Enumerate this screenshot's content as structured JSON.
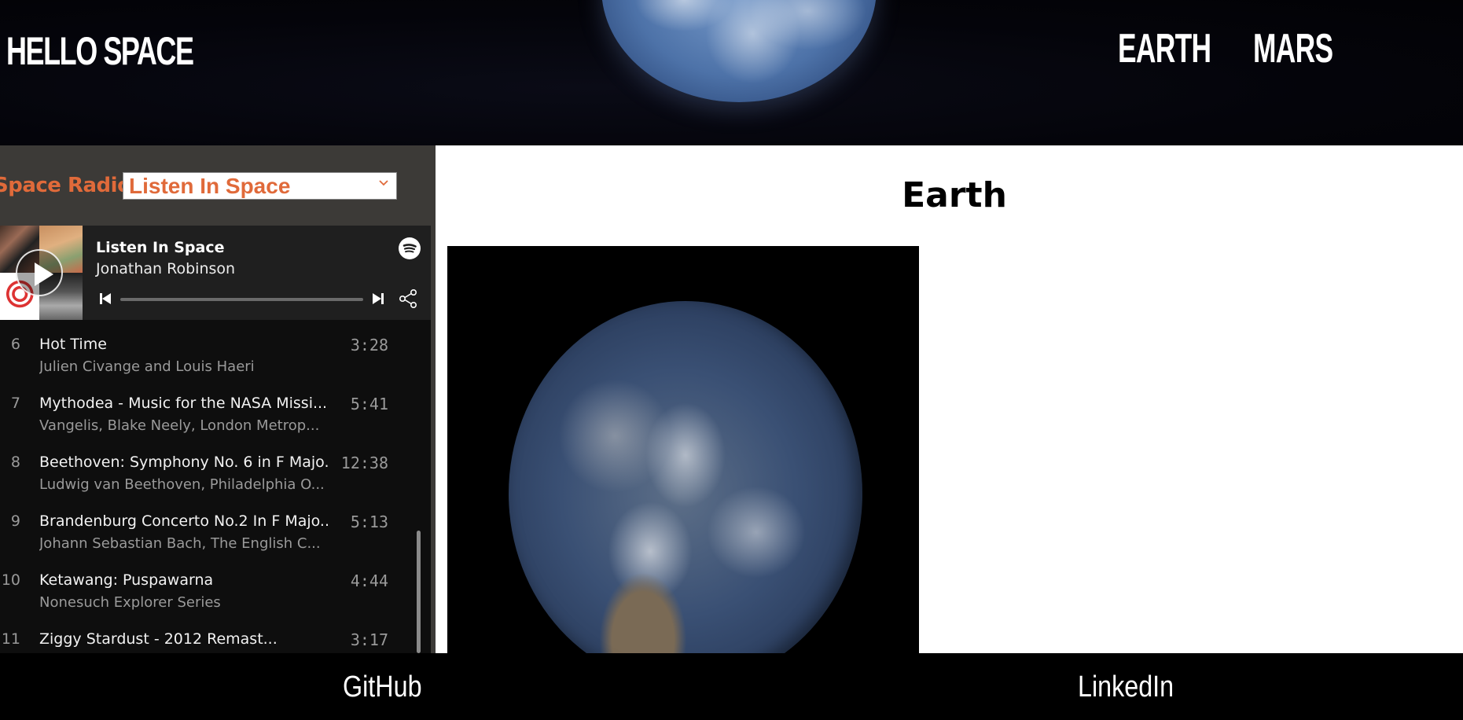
{
  "header": {
    "site_title": "HELLO SPACE",
    "nav": [
      {
        "label": "EARTH"
      },
      {
        "label": "MARS"
      }
    ]
  },
  "radio": {
    "label": "Space Radio",
    "select": {
      "selected": "Listen In Space",
      "options": [
        "Listen In Space"
      ]
    },
    "player": {
      "playlist_title": "Listen In Space",
      "owner": "Jonathan Robinson",
      "progress_percent": 0,
      "icons": {
        "play": "play-icon",
        "skip_back": "skip-back-icon",
        "skip_forward": "skip-forward-icon",
        "share": "share-icon",
        "brand": "spotify-icon"
      }
    },
    "tracks": [
      {
        "num": "",
        "name": "",
        "artist": "Julien Civange and Louis Haeri",
        "duration": ""
      },
      {
        "num": "6",
        "name": "Hot Time",
        "artist": "Julien Civange and Louis Haeri",
        "duration": "3:28"
      },
      {
        "num": "7",
        "name": "Mythodea - Music for the NASA Missi...",
        "artist": "Vangelis, Blake Neely, London Metrop...",
        "duration": "5:41"
      },
      {
        "num": "8",
        "name": "Beethoven: Symphony No. 6 in F Majo...",
        "artist": "Ludwig van Beethoven, Philadelphia O...",
        "duration": "12:38"
      },
      {
        "num": "9",
        "name": "Brandenburg Concerto No.2 In F Majo...",
        "artist": "Johann Sebastian Bach, The English C...",
        "duration": "5:13"
      },
      {
        "num": "10",
        "name": "Ketawang: Puspawarna",
        "artist": "Nonesuch Explorer Series",
        "duration": "4:44"
      },
      {
        "num": "11",
        "name": "Ziggy Stardust - 2012 Remast...",
        "artist": "",
        "duration": "3:17"
      }
    ]
  },
  "main": {
    "title": "Earth",
    "image_alt": "earth-photo"
  },
  "footer": {
    "links": [
      {
        "label": "GitHub"
      },
      {
        "label": "LinkedIn"
      }
    ]
  },
  "colors": {
    "accent": "#e06a3a",
    "panel_bg": "#3c3a37",
    "player_bg": "#1f1f1f",
    "tracklist_bg": "#0e0e0e"
  }
}
